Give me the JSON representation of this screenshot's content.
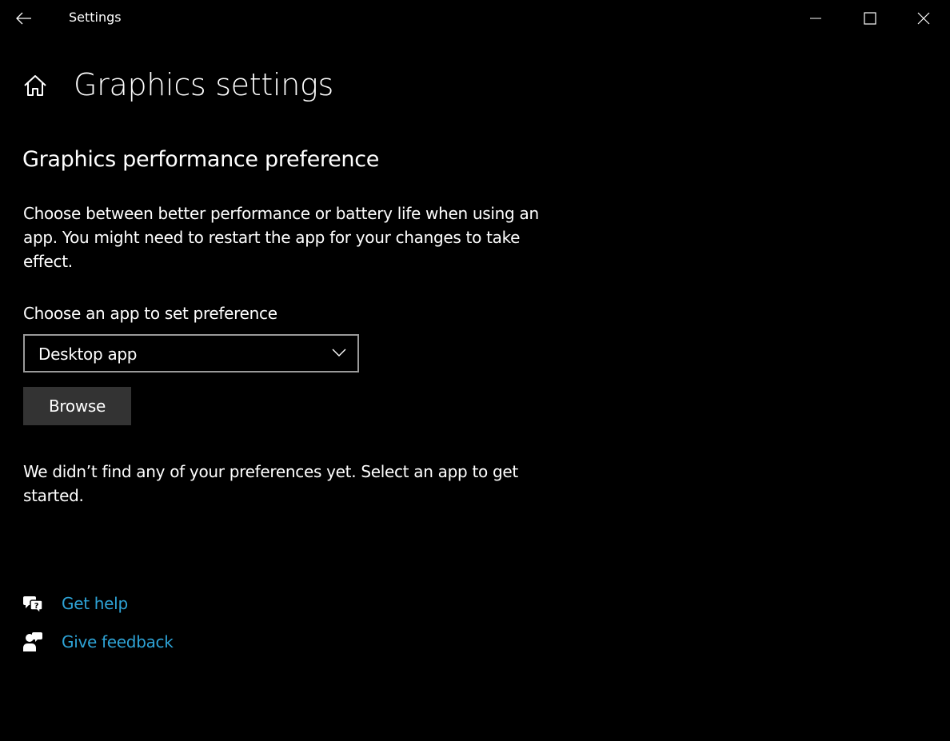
{
  "window": {
    "app_title": "Settings",
    "controls": [
      "minimize",
      "maximize",
      "close"
    ]
  },
  "page": {
    "title": "Graphics settings",
    "home_icon": "home-icon"
  },
  "section": {
    "title": "Graphics performance preference",
    "description": "Choose between better performance or battery life when using an app. You might need to restart the app for your changes to take effect."
  },
  "app_chooser": {
    "label": "Choose an app to set preference",
    "selected": "Desktop app",
    "browse_label": "Browse"
  },
  "empty_state": {
    "message": "We didn’t find any of your preferences yet. Select an app to get started."
  },
  "help_links": {
    "get_help": "Get help",
    "give_feedback": "Give feedback"
  },
  "colors": {
    "background": "#000000",
    "text": "#ffffff",
    "link": "#2ea3d6",
    "button": "#333333",
    "select_border": "#9a9a9a"
  }
}
